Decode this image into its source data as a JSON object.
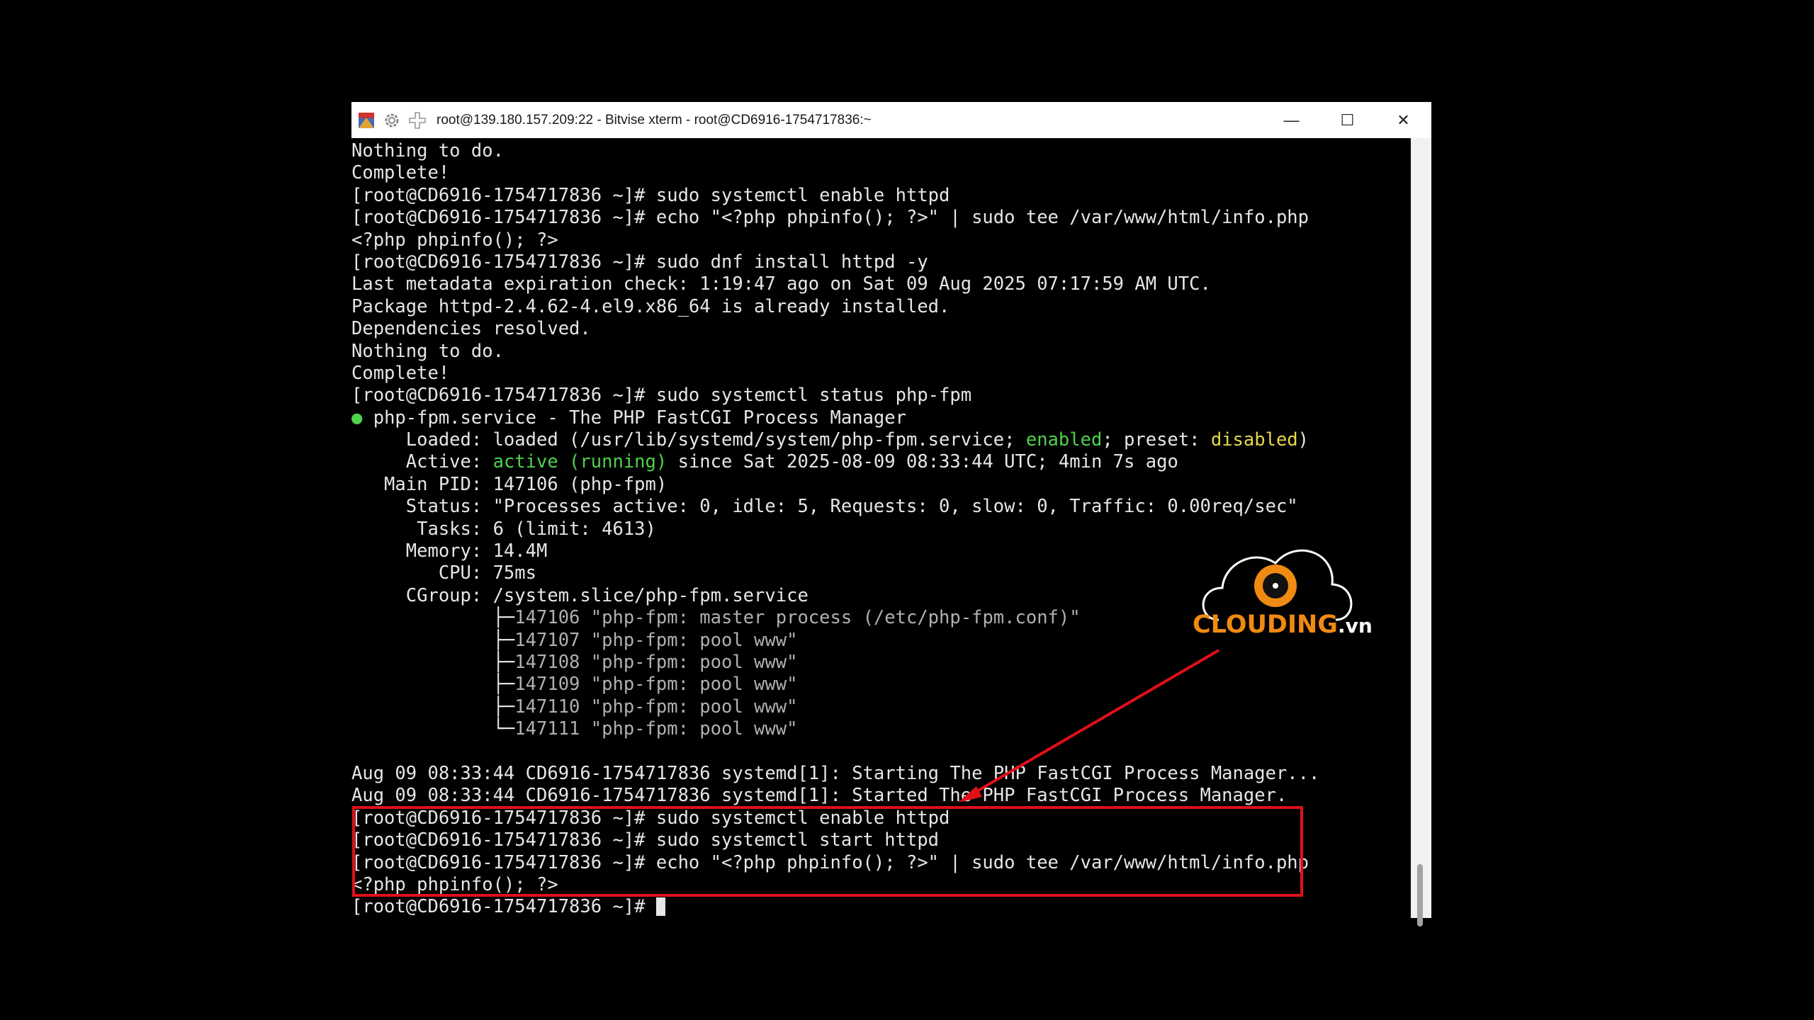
{
  "window": {
    "title": "root@139.180.157.209:22 - Bitvise xterm - root@CD6916-1754717836:~",
    "controls": {
      "minimize": "—",
      "maximize": "☐",
      "close": "✕"
    },
    "icons": [
      "app-icon",
      "gear-icon",
      "plus-icon"
    ]
  },
  "terminal": {
    "lines": [
      "Nothing to do.",
      "Complete!",
      "[root@CD6916-1754717836 ~]# sudo systemctl enable httpd",
      "[root@CD6916-1754717836 ~]# echo \"<?php phpinfo(); ?>\" | sudo tee /var/www/html/info.php",
      "<?php phpinfo(); ?>",
      "[root@CD6916-1754717836 ~]# sudo dnf install httpd -y",
      "Last metadata expiration check: 1:19:47 ago on Sat 09 Aug 2025 07:17:59 AM UTC.",
      "Package httpd-2.4.62-4.el9.x86_64 is already installed.",
      "Dependencies resolved.",
      "Nothing to do.",
      "Complete!",
      "[root@CD6916-1754717836 ~]# sudo systemctl status php-fpm"
    ],
    "status": {
      "dot": "●",
      "service": " php-fpm.service - The PHP FastCGI Process Manager",
      "loaded_prefix": "     Loaded: loaded (/usr/lib/systemd/system/php-fpm.service; ",
      "loaded_enabled": "enabled",
      "loaded_mid": "; preset: ",
      "loaded_disabled": "disabled",
      "loaded_suffix": ")",
      "active_prefix": "     Active: ",
      "active_state": "active (running)",
      "active_suffix": " since Sat 2025-08-09 08:33:44 UTC; 4min 7s ago",
      "main_pid": "   Main PID: 147106 (php-fpm)",
      "status_line": "     Status: \"Processes active: 0, idle: 5, Requests: 0, slow: 0, Traffic: 0.00req/sec\"",
      "tasks": "      Tasks: 6 (limit: 4613)",
      "memory": "     Memory: 14.4M",
      "cpu": "        CPU: 75ms",
      "cgroup": "     CGroup: /system.slice/php-fpm.service",
      "tree_prefixes": [
        "             ├─",
        "             ├─",
        "             ├─",
        "             ├─",
        "             ├─",
        "             └─"
      ],
      "tree": [
        "147106 \"php-fpm: master process (/etc/php-fpm.conf)\"",
        "147107 \"php-fpm: pool www\"",
        "147108 \"php-fpm: pool www\"",
        "147109 \"php-fpm: pool www\"",
        "147110 \"php-fpm: pool www\"",
        "147111 \"php-fpm: pool www\""
      ]
    },
    "after": [
      "",
      "Aug 09 08:33:44 CD6916-1754717836 systemd[1]: Starting The PHP FastCGI Process Manager...",
      "Aug 09 08:33:44 CD6916-1754717836 systemd[1]: Started The PHP FastCGI Process Manager.",
      "[root@CD6916-1754717836 ~]# sudo systemctl enable httpd",
      "[root@CD6916-1754717836 ~]# sudo systemctl start httpd",
      "[root@CD6916-1754717836 ~]# echo \"<?php phpinfo(); ?>\" | sudo tee /var/www/html/info.php",
      "<?php phpinfo(); ?>"
    ],
    "prompt": "[root@CD6916-1754717836 ~]# "
  },
  "logo": {
    "brand": "CLOUDING",
    "tld": ".vn"
  },
  "colors": {
    "highlight": "#e0101a",
    "brand_orange": "#f08a12",
    "term_green": "#4fd14a",
    "term_yellow": "#e6d84a"
  }
}
